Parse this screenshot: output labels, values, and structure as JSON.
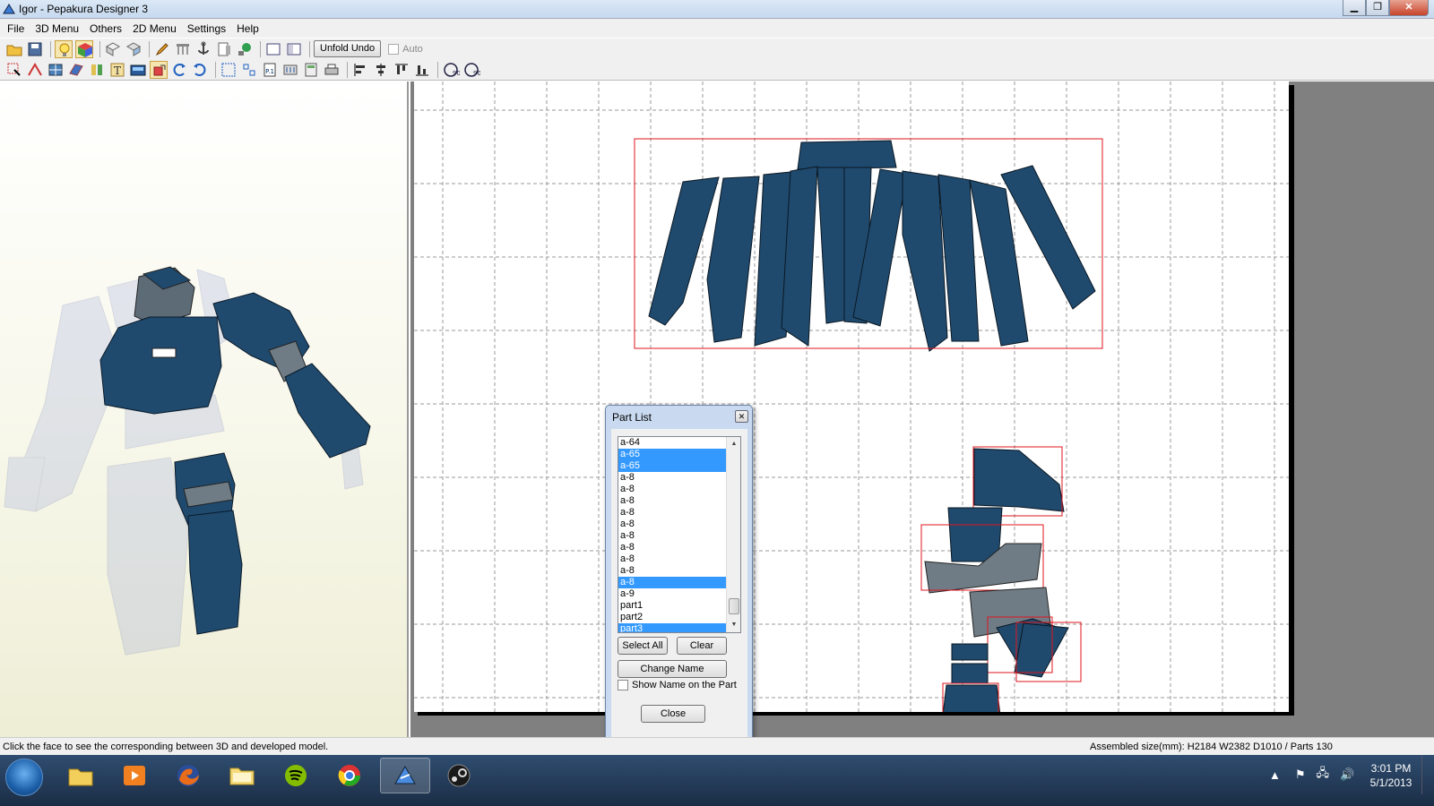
{
  "window": {
    "title": "Igor - Pepakura Designer 3",
    "controls": [
      "minimize",
      "maximize",
      "close"
    ]
  },
  "menu": [
    "File",
    "3D Menu",
    "Others",
    "2D Menu",
    "Settings",
    "Help"
  ],
  "toolbar1": {
    "unfold_undo_label": "Unfold Undo",
    "auto_label": "Auto"
  },
  "toolbar2": {
    "icons": [
      "select-icon",
      "edge-icon",
      "texture-icon",
      "flap-icon",
      "join-icon",
      "text-icon",
      "image-icon",
      "move-icon",
      "rotate-left-icon",
      "rotate-right-icon",
      "arrange-icon",
      "grid-arrange-icon",
      "page-icon",
      "numbering-icon",
      "calc-icon",
      "print-icon",
      "align-left-icon",
      "align-center-icon",
      "align-top-icon",
      "align-bottom-icon"
    ],
    "rotate_labels": [
      "90",
      "90"
    ]
  },
  "part_list": {
    "title": "Part List",
    "items": [
      {
        "label": "a-64",
        "selected": false
      },
      {
        "label": "a-65",
        "selected": true
      },
      {
        "label": "a-65",
        "selected": true
      },
      {
        "label": "a-8",
        "selected": false
      },
      {
        "label": "a-8",
        "selected": false
      },
      {
        "label": "a-8",
        "selected": false
      },
      {
        "label": "a-8",
        "selected": false
      },
      {
        "label": "a-8",
        "selected": false
      },
      {
        "label": "a-8",
        "selected": false
      },
      {
        "label": "a-8",
        "selected": false
      },
      {
        "label": "a-8",
        "selected": false
      },
      {
        "label": "a-8",
        "selected": false
      },
      {
        "label": "a-8",
        "selected": true
      },
      {
        "label": "a-9",
        "selected": false
      },
      {
        "label": "part1",
        "selected": false
      },
      {
        "label": "part2",
        "selected": false
      },
      {
        "label": "part3",
        "selected": true
      }
    ],
    "select_all_label": "Select All",
    "clear_label": "Clear",
    "change_name_label": "Change Name",
    "show_name_label": "Show Name on the Part",
    "close_label": "Close"
  },
  "status": {
    "left": "Click the face to see the corresponding between 3D and developed model.",
    "right": "Assembled size(mm): H2184 W2382 D1010 / Parts 130"
  },
  "taskbar": {
    "apps": [
      "explorer-icon",
      "media-player-icon",
      "firefox-icon",
      "folder-icon",
      "spotify-icon",
      "chrome-icon",
      "pepakura-icon",
      "steam-icon"
    ],
    "time": "3:01 PM",
    "date": "5/1/2013"
  },
  "colors": {
    "part_fill": "#1f4a6e",
    "part_gray": "#6f7c85",
    "selection_box": "#e0141e",
    "listbox_selection": "#3399ff"
  }
}
